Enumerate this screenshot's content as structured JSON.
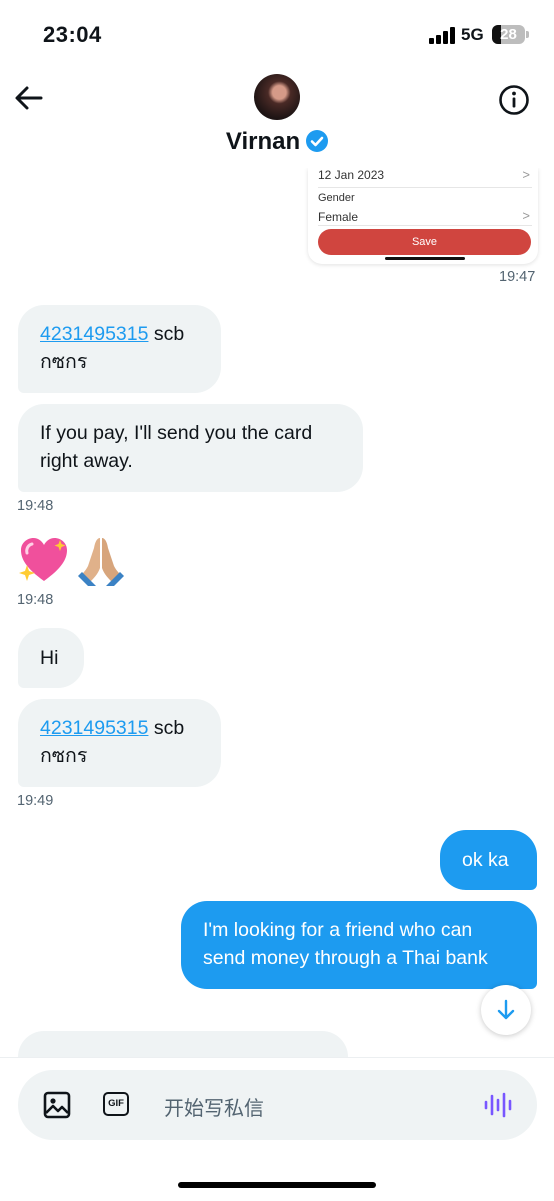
{
  "status_bar": {
    "time": "23:04",
    "network": "5G",
    "battery": "28"
  },
  "header": {
    "contact_name": "Virnan"
  },
  "image_message": {
    "date_value": "12 Jan 2023",
    "gender_label": "Gender",
    "gender_value": "Female",
    "save_label": "Save",
    "timestamp": "19:47"
  },
  "messages": [
    {
      "direction": "in",
      "account": "4231495315",
      "bank": " scb",
      "line2": "กซกร"
    },
    {
      "direction": "in",
      "text": "If you pay, I'll send you the card right away.",
      "timestamp": "19:48"
    },
    {
      "direction": "in",
      "emoji": "sparkling heart, folded hands",
      "timestamp": "19:48"
    },
    {
      "direction": "in",
      "text": "Hi"
    },
    {
      "direction": "in",
      "account": "4231495315",
      "bank": " scb",
      "line2": "กซกร",
      "timestamp": "19:49"
    },
    {
      "direction": "out",
      "text": "ok ka"
    },
    {
      "direction": "out",
      "text": "I'm looking for a friend who can send money through a Thai bank"
    }
  ],
  "composer": {
    "placeholder": "开始写私信",
    "gif_label": "GIF"
  },
  "colors": {
    "accent": "#1d9bf0",
    "bubble_in": "#eff3f4",
    "voice": "#7856ff"
  }
}
